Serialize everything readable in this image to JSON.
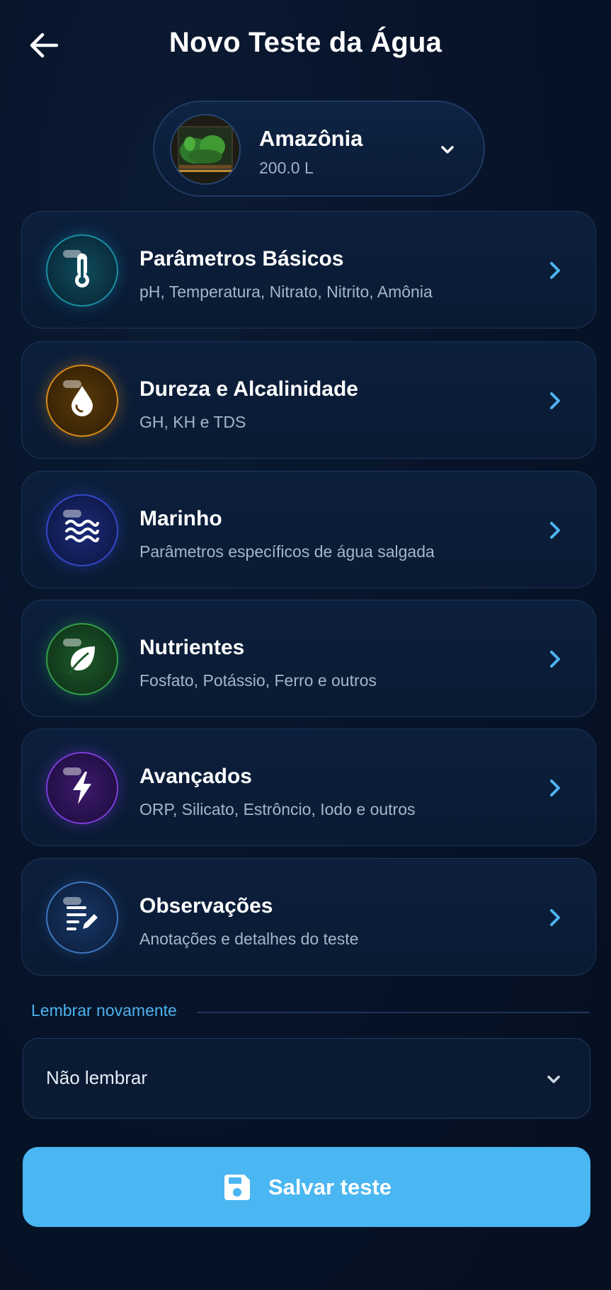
{
  "header": {
    "title": "Novo Teste da Água",
    "back_icon": "arrow-left-icon"
  },
  "aquarium": {
    "name": "Amazônia",
    "volume": "200.0 L",
    "chevron_icon": "chevron-down-icon"
  },
  "categories": [
    {
      "title": "Parâmetros Básicos",
      "subtitle": "pH, Temperatura, Nitrato, Nitrito, Amônia",
      "icon": "thermometer-icon",
      "color": "#1a8ea3"
    },
    {
      "title": "Dureza e Alcalinidade",
      "subtitle": "GH, KH e TDS",
      "icon": "water-drop-icon",
      "color": "#d98b14"
    },
    {
      "title": "Marinho",
      "subtitle": "Parâmetros específicos de água salgada",
      "icon": "waves-icon",
      "color": "#3447c9"
    },
    {
      "title": "Nutrientes",
      "subtitle": "Fosfato, Potássio, Ferro e outros",
      "icon": "leaf-icon",
      "color": "#34a04a"
    },
    {
      "title": "Avançados",
      "subtitle": "ORP, Silicato, Estrôncio, Iodo e outros",
      "icon": "lightning-icon",
      "color": "#7a3cd6"
    },
    {
      "title": "Observações",
      "subtitle": "Anotações e detalhes do teste",
      "icon": "notes-edit-icon",
      "color": "#3d77c0"
    }
  ],
  "reminder": {
    "label": "Lembrar novamente",
    "selected": "Não lembrar"
  },
  "save_button": {
    "label": "Salvar teste",
    "icon": "floppy-disk-icon"
  },
  "colors": {
    "accent": "#4ab6f2",
    "chevron": "#4db3ee",
    "background": "#07142a"
  }
}
